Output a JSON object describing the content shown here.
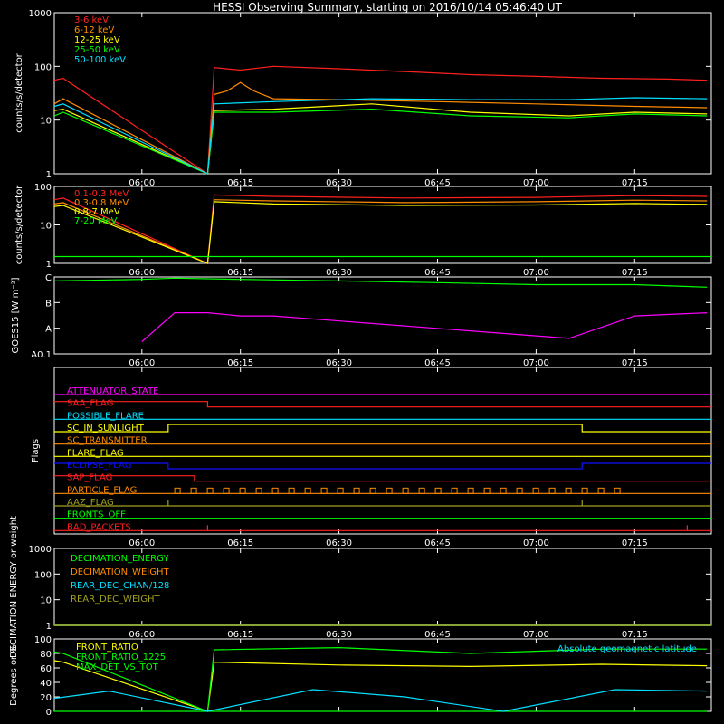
{
  "title": "HESSI Observing Summary, starting on 2016/10/14 05:46:40 UT",
  "x_ticks": [
    "06:00",
    "06:15",
    "06:30",
    "06:45",
    "07:00",
    "07:15"
  ],
  "colors": {
    "background": "#000000",
    "axis": "#ffffff",
    "red": "#ff2020",
    "orange": "#ff8c00",
    "yellow": "#ffff00",
    "green": "#00ff00",
    "cyan": "#00e0ff",
    "magenta": "#ff00ff",
    "blue": "#1010ff",
    "olive": "#a0a020"
  },
  "chart_data": [
    {
      "type": "line",
      "ylabel": "counts/s/detector",
      "yscale": "log",
      "ylim": [
        1,
        1000
      ],
      "y_ticks": [
        "1",
        "10",
        "100",
        "1000"
      ],
      "x_range": [
        "05:46:40",
        "07:26:40"
      ],
      "series": [
        {
          "name": "3-6 keV",
          "color": "red",
          "x": [
            "05:46:40",
            "05:48",
            "06:10",
            "06:11",
            "06:15",
            "06:20",
            "06:30",
            "06:40",
            "06:50",
            "07:00",
            "07:10",
            "07:20",
            "07:26"
          ],
          "values": [
            55,
            60,
            1,
            95,
            85,
            100,
            90,
            80,
            70,
            65,
            60,
            58,
            55
          ]
        },
        {
          "name": "6-12 keV",
          "color": "orange",
          "x": [
            "05:46:40",
            "05:48",
            "06:10",
            "06:11",
            "06:13",
            "06:15",
            "06:17",
            "06:20",
            "06:30",
            "06:45",
            "07:00",
            "07:15",
            "07:26"
          ],
          "values": [
            20,
            25,
            1,
            30,
            35,
            50,
            35,
            25,
            24,
            22,
            20,
            18,
            17
          ]
        },
        {
          "name": "12-25 keV",
          "color": "yellow",
          "x": [
            "05:46:40",
            "05:48",
            "06:10",
            "06:11",
            "06:20",
            "06:35",
            "06:50",
            "07:05",
            "07:15",
            "07:26"
          ],
          "values": [
            15,
            16,
            1,
            15,
            16,
            20,
            14,
            12,
            14,
            13
          ]
        },
        {
          "name": "25-50 keV",
          "color": "green",
          "x": [
            "05:46:40",
            "05:48",
            "06:10",
            "06:11",
            "06:20",
            "06:35",
            "06:50",
            "07:05",
            "07:15",
            "07:26"
          ],
          "values": [
            12,
            14,
            1,
            14,
            14,
            16,
            12,
            11,
            13,
            12
          ]
        },
        {
          "name": "50-100 keV",
          "color": "cyan",
          "x": [
            "05:46:40",
            "05:48",
            "06:10",
            "06:11",
            "06:20",
            "06:35",
            "06:50",
            "07:05",
            "07:15",
            "07:26"
          ],
          "values": [
            18,
            20,
            1,
            20,
            22,
            25,
            24,
            24,
            26,
            25
          ]
        }
      ]
    },
    {
      "type": "line",
      "ylabel": "counts/s/detector",
      "yscale": "log",
      "ylim": [
        1,
        100
      ],
      "y_ticks": [
        "1",
        "10",
        "100"
      ],
      "x_range": [
        "05:46:40",
        "07:26:40"
      ],
      "series": [
        {
          "name": "0.1-0.3 MeV",
          "color": "red",
          "x": [
            "05:46:40",
            "05:48",
            "06:10",
            "06:11",
            "06:20",
            "06:40",
            "07:00",
            "07:15",
            "07:26"
          ],
          "values": [
            45,
            50,
            1,
            60,
            55,
            50,
            52,
            58,
            55
          ]
        },
        {
          "name": "0.3-0.8 MeV",
          "color": "orange",
          "x": [
            "05:46:40",
            "05:48",
            "06:10",
            "06:11",
            "06:20",
            "06:40",
            "07:00",
            "07:15",
            "07:26"
          ],
          "values": [
            35,
            38,
            1,
            45,
            42,
            38,
            40,
            44,
            42
          ]
        },
        {
          "name": "0.8-7 MeV",
          "color": "yellow",
          "x": [
            "05:46:40",
            "05:48",
            "06:10",
            "06:11",
            "06:20",
            "06:40",
            "07:00",
            "07:15",
            "07:26"
          ],
          "values": [
            30,
            32,
            1,
            40,
            35,
            32,
            33,
            36,
            34
          ]
        },
        {
          "name": "7-20 MeV",
          "color": "green",
          "x": [
            "05:46:40",
            "07:26:40"
          ],
          "values": [
            1.5,
            1.5
          ]
        }
      ]
    },
    {
      "type": "line",
      "ylabel": "GOES15 [W m⁻²]",
      "yscale": "log",
      "y_ticks": [
        "A0.1",
        "A",
        "B",
        "C"
      ],
      "x_range": [
        "05:46:40",
        "07:26:40"
      ],
      "series": [
        {
          "color": "green",
          "x": [
            "05:46:40",
            "06:00",
            "06:05",
            "06:15",
            "06:30",
            "06:45",
            "07:00",
            "07:15",
            "07:26"
          ],
          "values": [
            "B7",
            "B8",
            "B9",
            "B8",
            "B7",
            "B6",
            "B5",
            "B5",
            "B4"
          ]
        },
        {
          "color": "magenta",
          "x": [
            "06:00",
            "06:05",
            "06:10",
            "06:15",
            "06:20",
            "07:05",
            "07:15",
            "07:26"
          ],
          "values": [
            "A0.3",
            "A4",
            "A4",
            "A3",
            "A3",
            "A0.4",
            "A3",
            "A4"
          ]
        }
      ]
    },
    {
      "type": "line",
      "ylabel": "Flags",
      "flags": [
        {
          "name": "ATTENUATOR_STATE",
          "color": "magenta"
        },
        {
          "name": "SAA_FLAG",
          "color": "red",
          "high_until": "06:10"
        },
        {
          "name": "POSSIBLE_FLARE",
          "color": "cyan"
        },
        {
          "name": "SC_IN_SUNLIGHT",
          "color": "yellow",
          "high_from": "06:04",
          "high_until": "07:07"
        },
        {
          "name": "SC_TRANSMITTER",
          "color": "orange"
        },
        {
          "name": "FLARE_FLAG",
          "color": "yellow"
        },
        {
          "name": "ECLIPSE_FLAG",
          "color": "blue",
          "high_until": "06:04",
          "high_from2": "07:07"
        },
        {
          "name": "SAP_FLAG",
          "color": "red",
          "high_until": "06:08"
        },
        {
          "name": "PARTICLE_FLAG",
          "color": "orange",
          "intermittent": true
        },
        {
          "name": "AAZ_FLAG",
          "color": "olive",
          "spikes": [
            "06:04",
            "07:07"
          ]
        },
        {
          "name": "FRONTS_OFF",
          "color": "green"
        },
        {
          "name": "BAD_PACKETS",
          "color": "red",
          "spikes": [
            "06:10",
            "07:23"
          ]
        }
      ]
    },
    {
      "type": "line",
      "ylabel": "DECIMATION ENERGY or weight",
      "yscale": "log",
      "ylim": [
        1,
        1000
      ],
      "y_ticks": [
        "1",
        "10",
        "100",
        "1000"
      ],
      "series": [
        {
          "name": "DECIMATION_ENERGY",
          "color": "green",
          "x": [
            "05:46:40",
            "07:26:40"
          ],
          "values": [
            1,
            1
          ]
        },
        {
          "name": "DECIMATION_WEIGHT",
          "color": "orange",
          "x": [
            "05:46:40",
            "07:26:40"
          ],
          "values": [
            1,
            1
          ]
        },
        {
          "name": "REAR_DEC_CHAN/128",
          "color": "cyan",
          "x": [
            "05:46:40",
            "07:26:40"
          ],
          "values": [
            1,
            1
          ]
        },
        {
          "name": "REAR_DEC_WEIGHT",
          "color": "olive",
          "x": [
            "05:46:40",
            "07:26:40"
          ],
          "values": [
            1,
            1
          ]
        }
      ]
    },
    {
      "type": "line",
      "ylabel": "Degrees or %",
      "ylim": [
        0,
        100
      ],
      "y_ticks": [
        "0",
        "20",
        "40",
        "60",
        "80",
        "100"
      ],
      "annotation": "Absolute geomagnetic latitude",
      "series": [
        {
          "name": "FRONT_RATIO",
          "color": "yellow",
          "x": [
            "05:46:40",
            "05:48",
            "06:10",
            "06:11",
            "06:30",
            "06:50",
            "07:10",
            "07:26"
          ],
          "values": [
            70,
            68,
            0,
            68,
            64,
            62,
            65,
            63
          ]
        },
        {
          "name": "FRONT_RATIO_1225",
          "color": "green",
          "x": [
            "05:46:40",
            "05:48",
            "06:10",
            "06:11",
            "06:30",
            "06:50",
            "07:10",
            "07:26"
          ],
          "values": [
            82,
            80,
            0,
            85,
            88,
            80,
            86,
            86
          ]
        },
        {
          "name": "MAX_DET_VS_TOT",
          "color": "green",
          "x": [
            "05:46:40",
            "05:48",
            "06:10",
            "06:11",
            "07:26"
          ],
          "values": [
            0,
            0,
            0,
            0,
            0
          ]
        },
        {
          "color": "cyan",
          "x": [
            "05:46:40",
            "05:55",
            "06:10",
            "06:26",
            "06:40",
            "06:55",
            "07:12",
            "07:26"
          ],
          "values": [
            18,
            28,
            0,
            30,
            20,
            0,
            30,
            28
          ]
        }
      ]
    }
  ]
}
